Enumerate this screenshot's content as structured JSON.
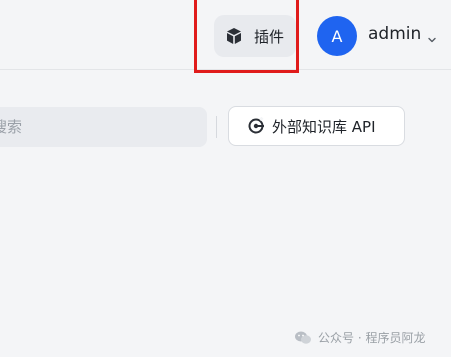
{
  "header": {
    "plugin_button": {
      "label": "插件",
      "icon": "cube-icon"
    },
    "user": {
      "avatar_letter": "A",
      "name": "admin",
      "caret_icon": "chevron-down-icon"
    }
  },
  "toolbar": {
    "search": {
      "placeholder": "搜索"
    },
    "api_button": {
      "label": "外部知识库 API",
      "icon": "external-api-icon"
    }
  },
  "watermark": {
    "text": "公众号 · 程序员阿龙",
    "icon": "wechat-icon"
  },
  "colors": {
    "accent": "#1f64f0",
    "highlight": "#e01b1b",
    "background": "#f4f5f7"
  }
}
